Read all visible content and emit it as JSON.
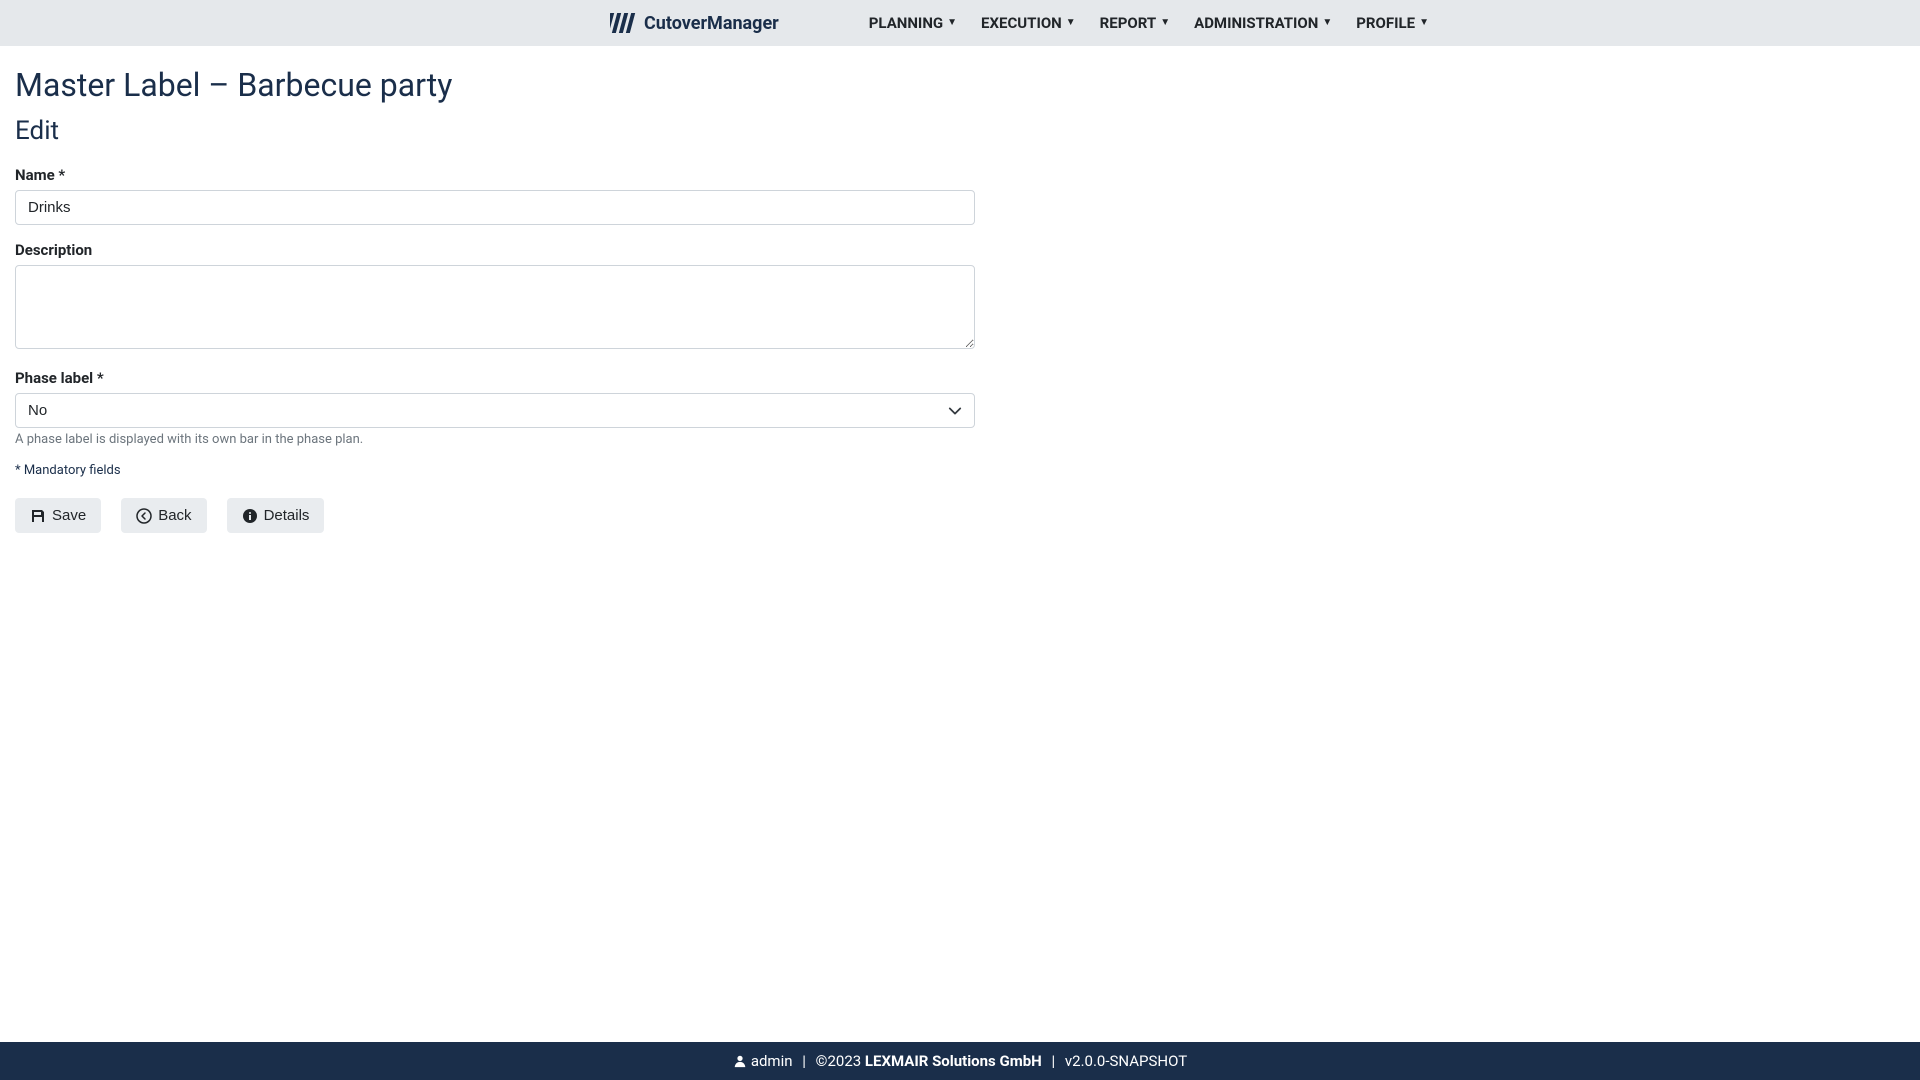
{
  "brand": {
    "name": "CutoverManager"
  },
  "nav": {
    "planning": "PLANNING",
    "execution": "EXECUTION",
    "report": "REPORT",
    "administration": "ADMINISTRATION",
    "profile": "PROFILE"
  },
  "page": {
    "title": "Master Label  –  Barbecue party",
    "section": "Edit"
  },
  "form": {
    "name": {
      "label": "Name *",
      "value": "Drinks"
    },
    "description": {
      "label": "Description",
      "value": ""
    },
    "phaseLabel": {
      "label": "Phase label *",
      "selected": "No",
      "help": "A phase label is displayed with its own bar in the phase plan."
    },
    "mandatoryNote": "* Mandatory fields"
  },
  "buttons": {
    "save": "Save",
    "back": "Back",
    "details": "Details"
  },
  "footer": {
    "user": "admin",
    "copyrightPrefix": "©2023",
    "company": "LEXMAIR Solutions GmbH",
    "version": "v2.0.0-SNAPSHOT",
    "separator": "|"
  }
}
